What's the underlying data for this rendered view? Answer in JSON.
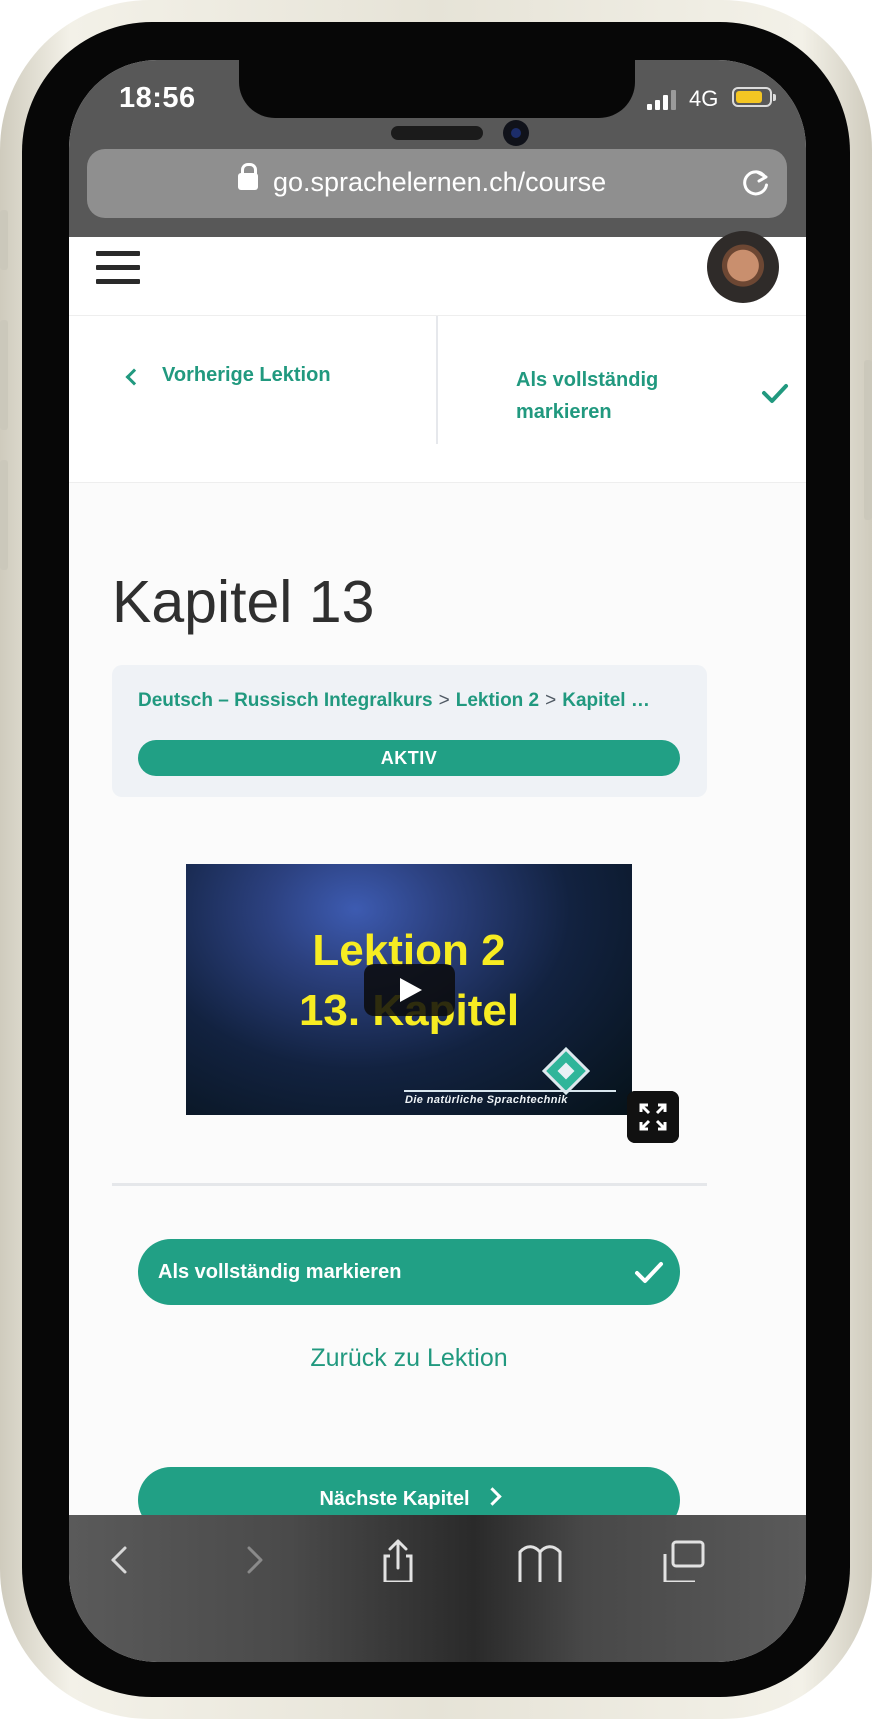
{
  "status_bar": {
    "time": "18:56",
    "network": "4G"
  },
  "browser": {
    "url": "go.sprachelernen.ch/course"
  },
  "lesson_nav": {
    "prev_label": "Vorherige Lektion",
    "complete_label": "Als vollständig markieren"
  },
  "page": {
    "title": "Kapitel 13",
    "breadcrumb": [
      "Deutsch – Russisch Integralkurs",
      "Lektion 2",
      "Kapitel …"
    ],
    "breadcrumb_separator": ">",
    "status": "AKTIV"
  },
  "video": {
    "line1": "Lektion 2",
    "line2": "13. Kapitel",
    "tagline": "Die natürliche Sprachtechnik"
  },
  "actions": {
    "complete_label": "Als vollständig markieren",
    "back_label": "Zurück zu Lektion",
    "next_label": "Nächste Kapitel"
  },
  "colors": {
    "accent": "#21a085",
    "chrome": "#585858",
    "video_text": "#f7ec22"
  },
  "icons": [
    "lock-icon",
    "reload-icon",
    "menu-icon",
    "chevron-left-icon",
    "check-icon",
    "play-icon",
    "fullscreen-icon",
    "back-icon",
    "forward-icon",
    "share-icon",
    "bookmarks-icon",
    "tabs-icon"
  ]
}
